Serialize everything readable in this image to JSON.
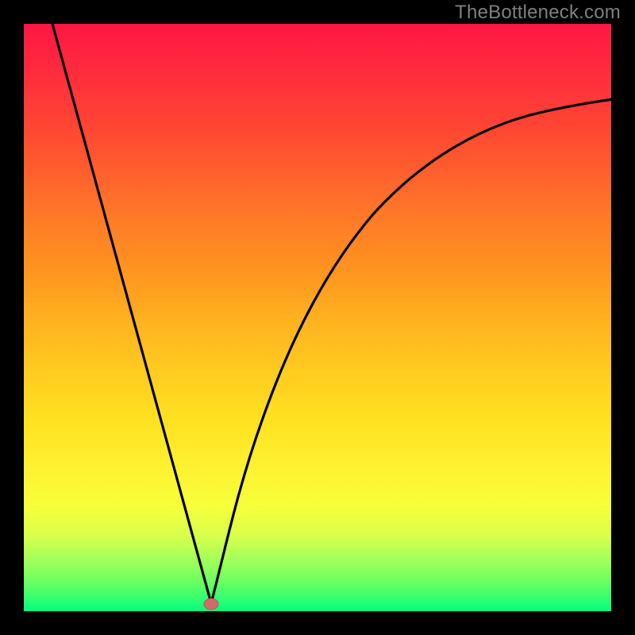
{
  "watermark": "TheBottleneck.com",
  "chart_data": {
    "type": "line",
    "title": "",
    "xlabel": "",
    "ylabel": "",
    "xlim": [
      0,
      100
    ],
    "ylim": [
      0,
      100
    ],
    "series": [
      {
        "name": "left-branch",
        "x": [
          5,
          10,
          15,
          20,
          25,
          30,
          32
        ],
        "values": [
          100,
          82,
          64,
          46,
          28,
          10,
          1
        ]
      },
      {
        "name": "right-branch",
        "x": [
          32,
          34,
          36,
          40,
          45,
          50,
          55,
          60,
          65,
          70,
          75,
          80,
          85,
          90,
          95,
          100
        ],
        "values": [
          1,
          8,
          16,
          30,
          43,
          53,
          60,
          66,
          71,
          75,
          78,
          80,
          82,
          83.5,
          84.5,
          85.5
        ]
      }
    ],
    "marker": {
      "x": 32,
      "y": 1,
      "color": "#d36a6a"
    },
    "background_gradient": {
      "top": "#ff1745",
      "mid": "#ffc820",
      "bottom": "#00ff80"
    },
    "annotations": []
  }
}
